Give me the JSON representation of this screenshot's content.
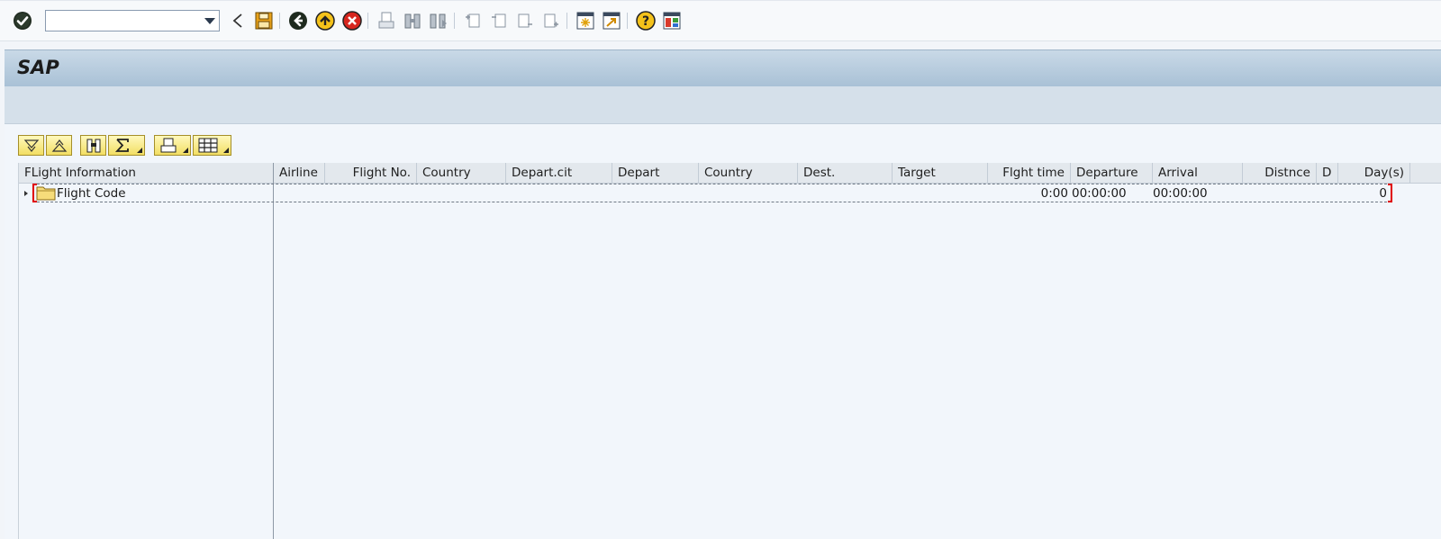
{
  "system_toolbar": {
    "command_field": {
      "value": "",
      "placeholder": ""
    },
    "icons": [
      "enter-check-icon",
      "back-triangle-icon",
      "save-icon",
      "back-icon",
      "exit-icon",
      "cancel-icon",
      "print-icon",
      "find-icon",
      "find-next-icon",
      "first-page-icon",
      "previous-page-icon",
      "next-page-icon",
      "last-page-icon",
      "create-session-icon",
      "generate-shortcut-icon",
      "help-icon",
      "customize-layout-icon"
    ]
  },
  "title_bar": {
    "title": "SAP"
  },
  "alv_toolbar": {
    "icons": [
      "expand-all-icon",
      "collapse-all-icon",
      "find-icon",
      "sum-icon",
      "print-icon",
      "layout-icon"
    ]
  },
  "grid": {
    "columns": [
      {
        "label": "FLight Information",
        "align": "left"
      },
      {
        "label": "Airline",
        "align": "left"
      },
      {
        "label": "Flight No.",
        "align": "right"
      },
      {
        "label": "Country",
        "align": "left"
      },
      {
        "label": "Depart.cit",
        "align": "left"
      },
      {
        "label": "Depart",
        "align": "left"
      },
      {
        "label": "Country",
        "align": "left"
      },
      {
        "label": "Dest.",
        "align": "left"
      },
      {
        "label": "Target",
        "align": "left"
      },
      {
        "label": "Flght time",
        "align": "right"
      },
      {
        "label": "Departure",
        "align": "left"
      },
      {
        "label": "Arrival",
        "align": "left"
      },
      {
        "label": "Distnce",
        "align": "right"
      },
      {
        "label": "D",
        "align": "left"
      },
      {
        "label": "Day(s)",
        "align": "right"
      }
    ],
    "rows": [
      {
        "node_label": "Flight Code",
        "flight_time": "0:00",
        "departure": "00:00:00",
        "arrival": "00:00:00",
        "days": "0"
      }
    ]
  },
  "colors": {
    "title_gradient_top": "#c9d9e7",
    "title_gradient_bottom": "#a9c1d6",
    "alv_button_yellow": "#f2de63",
    "focus_red": "#e00000"
  }
}
